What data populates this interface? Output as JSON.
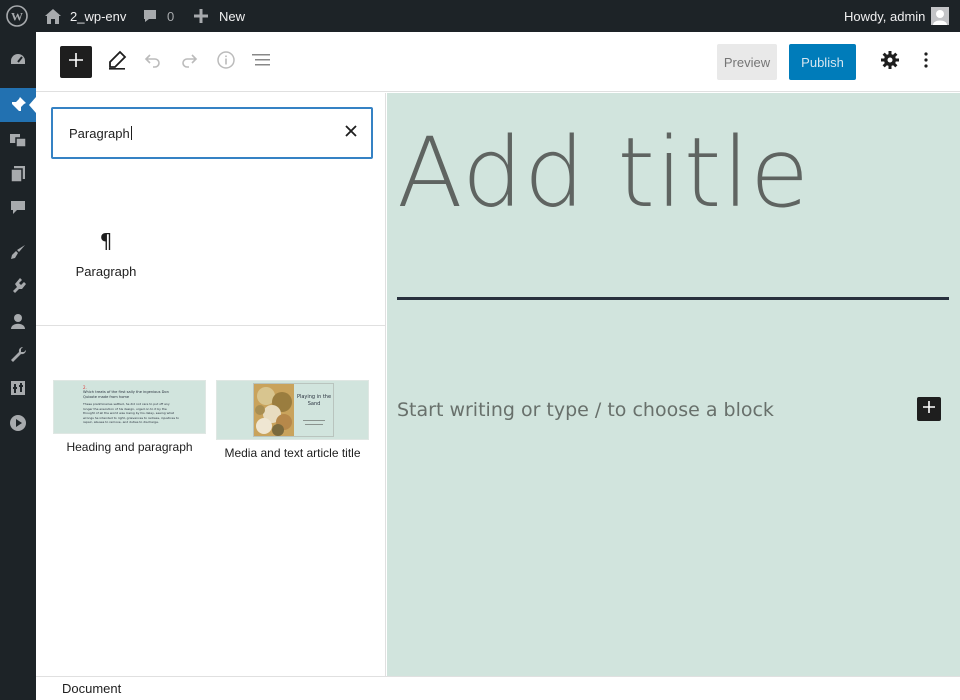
{
  "admin_bar": {
    "site_name": "2_wp-env",
    "comments_count": "0",
    "new_label": "New",
    "greeting": "Howdy, admin"
  },
  "sidebar_menu": [
    {
      "icon": "dashboard-icon",
      "active": false
    },
    {
      "icon": "pushpin-icon",
      "active": true
    },
    {
      "icon": "media-icon",
      "active": false
    },
    {
      "icon": "pages-icon",
      "active": false
    },
    {
      "icon": "comments-icon",
      "active": false
    },
    {
      "icon": "appearance-icon",
      "active": false
    },
    {
      "icon": "plugins-icon",
      "active": false
    },
    {
      "icon": "users-icon",
      "active": false
    },
    {
      "icon": "tools-icon",
      "active": false
    },
    {
      "icon": "settings-icon",
      "active": false
    },
    {
      "icon": "play-icon",
      "active": false
    }
  ],
  "toolbar": {
    "preview_label": "Preview",
    "publish_label": "Publish"
  },
  "inserter": {
    "search_value": "Paragraph",
    "block_result_label": "Paragraph",
    "pattern_1": {
      "label": "Heading and paragraph",
      "preview_heading_num": "2.",
      "preview_heading": "Which treats of the first sally the ingenious Don Quixote made from home",
      "preview_body": "These preliminaries settled, he did not care to put off any longer the execution of his design, urged on to it by the thought of all the world was losing by his delay, seeing what wrongs he intended to right, grievances to redress, injustices to repair, abuses to remove, and duties to discharge."
    },
    "pattern_2": {
      "label": "Media and text article title",
      "preview_title": "Playing in the Sand"
    }
  },
  "canvas": {
    "title_placeholder": "Add title",
    "body_placeholder": "Start writing or type / to choose a block"
  },
  "footer": {
    "breadcrumb": "Document"
  }
}
